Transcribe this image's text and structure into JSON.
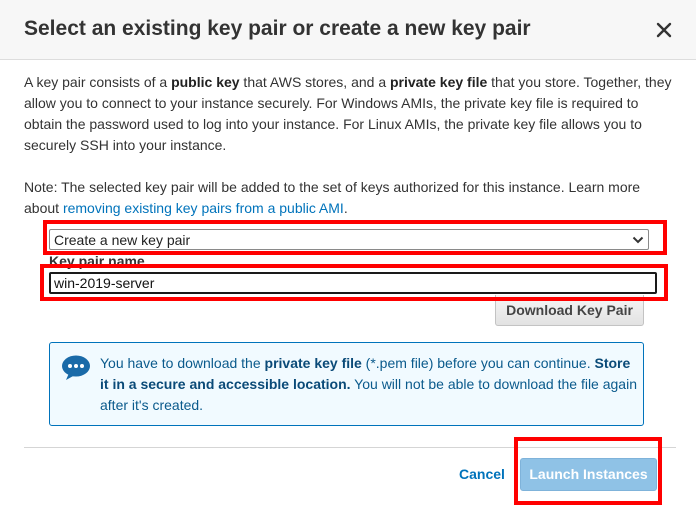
{
  "dialog": {
    "title": "Select an existing key pair or create a new key pair",
    "close_label": "×"
  },
  "intro": {
    "t1": "A key pair consists of a ",
    "b1": "public key",
    "t2": " that AWS stores, and a ",
    "b2": "private key file",
    "t3": " that you store. Together, they allow you to connect to your instance securely. For Windows AMIs, the private key file is required to obtain the password used to log into your instance. For Linux AMIs, the private key file allows you to securely SSH into your instance."
  },
  "note": {
    "text": "Note: The selected key pair will be added to the set of keys authorized for this instance. Learn more about ",
    "link": "removing existing key pairs from a public AMI",
    "end": "."
  },
  "key_pair_select": {
    "selected": "Create a new key pair"
  },
  "key_pair_name": {
    "label": "Key pair name",
    "value": "win-2019-server"
  },
  "download_button": "Download Key Pair",
  "info": {
    "t1": "You have to download the ",
    "b1": "private key file",
    "t2": " (*.pem file) before you can continue. ",
    "b2": "Store it in a secure and accessible location.",
    "t3": " You will not be able to download the file again after it's created."
  },
  "footer": {
    "cancel": "Cancel",
    "launch": "Launch Instances"
  },
  "colors": {
    "link": "#0073bb",
    "primary_disabled": "#8fc2e6",
    "highlight": "#ff0000",
    "info_border": "#0073bb",
    "info_background": "#f1faff"
  }
}
